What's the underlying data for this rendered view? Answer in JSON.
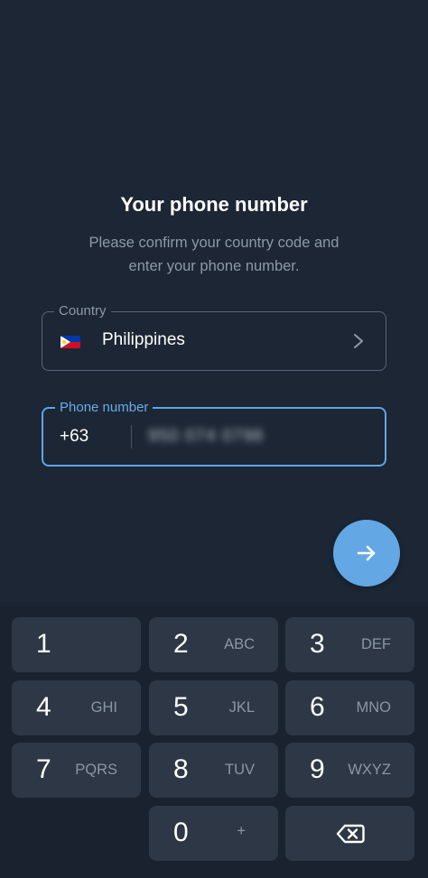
{
  "header": {
    "title": "Your phone number",
    "subtitle_line1": "Please confirm your country code and",
    "subtitle_line2": "enter your phone number."
  },
  "country_field": {
    "label": "Country",
    "value": "Philippines",
    "flag_icon": "philippines-flag-icon",
    "chevron_icon": "chevron-right-icon"
  },
  "phone_field": {
    "label": "Phone number",
    "country_code": "+63",
    "number": "950 074 0798",
    "number_obscured": true
  },
  "next_button": {
    "icon": "arrow-right-icon",
    "color": "#63a7e5"
  },
  "keypad": {
    "keys": [
      {
        "digit": "1",
        "letters": ""
      },
      {
        "digit": "2",
        "letters": "ABC"
      },
      {
        "digit": "3",
        "letters": "DEF"
      },
      {
        "digit": "4",
        "letters": "GHI"
      },
      {
        "digit": "5",
        "letters": "JKL"
      },
      {
        "digit": "6",
        "letters": "MNO"
      },
      {
        "digit": "7",
        "letters": "PQRS"
      },
      {
        "digit": "8",
        "letters": "TUV"
      },
      {
        "digit": "9",
        "letters": "WXYZ"
      },
      {
        "digit": "0",
        "letters": "+"
      }
    ],
    "backspace_icon": "backspace-icon"
  },
  "colors": {
    "background": "#1c2634",
    "accent": "#5ea5e6",
    "key_background": "#2d3745",
    "secondary_text": "#8d99a8"
  }
}
